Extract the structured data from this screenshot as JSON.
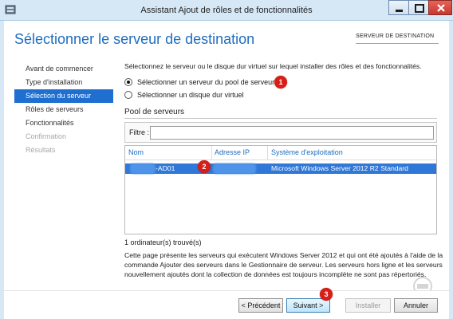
{
  "window": {
    "title": "Assistant Ajout de rôles et de fonctionnalités",
    "icons": {
      "app": "server-manager-icon",
      "minimize": "minimize-icon",
      "maximize": "maximize-icon",
      "close": "close-icon"
    }
  },
  "header": {
    "page_title": "Sélectionner le serveur de destination",
    "destination_label": "SERVEUR DE DESTINATION"
  },
  "sidebar": {
    "items": [
      {
        "label": "Avant de commencer",
        "state": "normal"
      },
      {
        "label": "Type d'installation",
        "state": "normal"
      },
      {
        "label": "Sélection du serveur",
        "state": "active"
      },
      {
        "label": "Rôles de serveurs",
        "state": "normal"
      },
      {
        "label": "Fonctionnalités",
        "state": "normal"
      },
      {
        "label": "Confirmation",
        "state": "disabled"
      },
      {
        "label": "Résultats",
        "state": "disabled"
      }
    ]
  },
  "main": {
    "intro": "Sélectionnez le serveur ou le disque dur virtuel sur lequel installer des rôles et des fonctionnalités.",
    "options": [
      {
        "label": "Sélectionner un serveur du pool de serveurs",
        "checked": true
      },
      {
        "label": "Sélectionner un disque dur virtuel",
        "checked": false
      }
    ],
    "pool": {
      "title": "Pool de serveurs",
      "filter_label": "Filtre :",
      "filter_value": "",
      "columns": [
        "Nom",
        "Adresse IP",
        "Système d'exploitation"
      ],
      "rows": [
        {
          "name": "-AD01",
          "ip": "",
          "os": "Microsoft Windows Server 2012 R2 Standard",
          "selected": true
        }
      ],
      "found": "1 ordinateur(s) trouvé(s)"
    },
    "description": "Cette page présente les serveurs qui exécutent Windows Server 2012 et qui ont été ajoutés à l'aide de la commande Ajouter des serveurs dans le Gestionnaire de serveur. Les serveurs hors ligne et les serveurs nouvellement ajoutés dont la collection de données est toujours incomplète ne sont pas répertoriés."
  },
  "annotations": {
    "badge1": "1",
    "badge2": "2",
    "badge3": "3"
  },
  "buttons": {
    "previous": "< Précédent",
    "next": "Suivant >",
    "install": "Installer",
    "cancel": "Annuler"
  },
  "colors": {
    "accent": "#1e6dbf",
    "selection": "#3078d8",
    "badge": "#d81e17",
    "titlebar": "#d6e8f6"
  }
}
